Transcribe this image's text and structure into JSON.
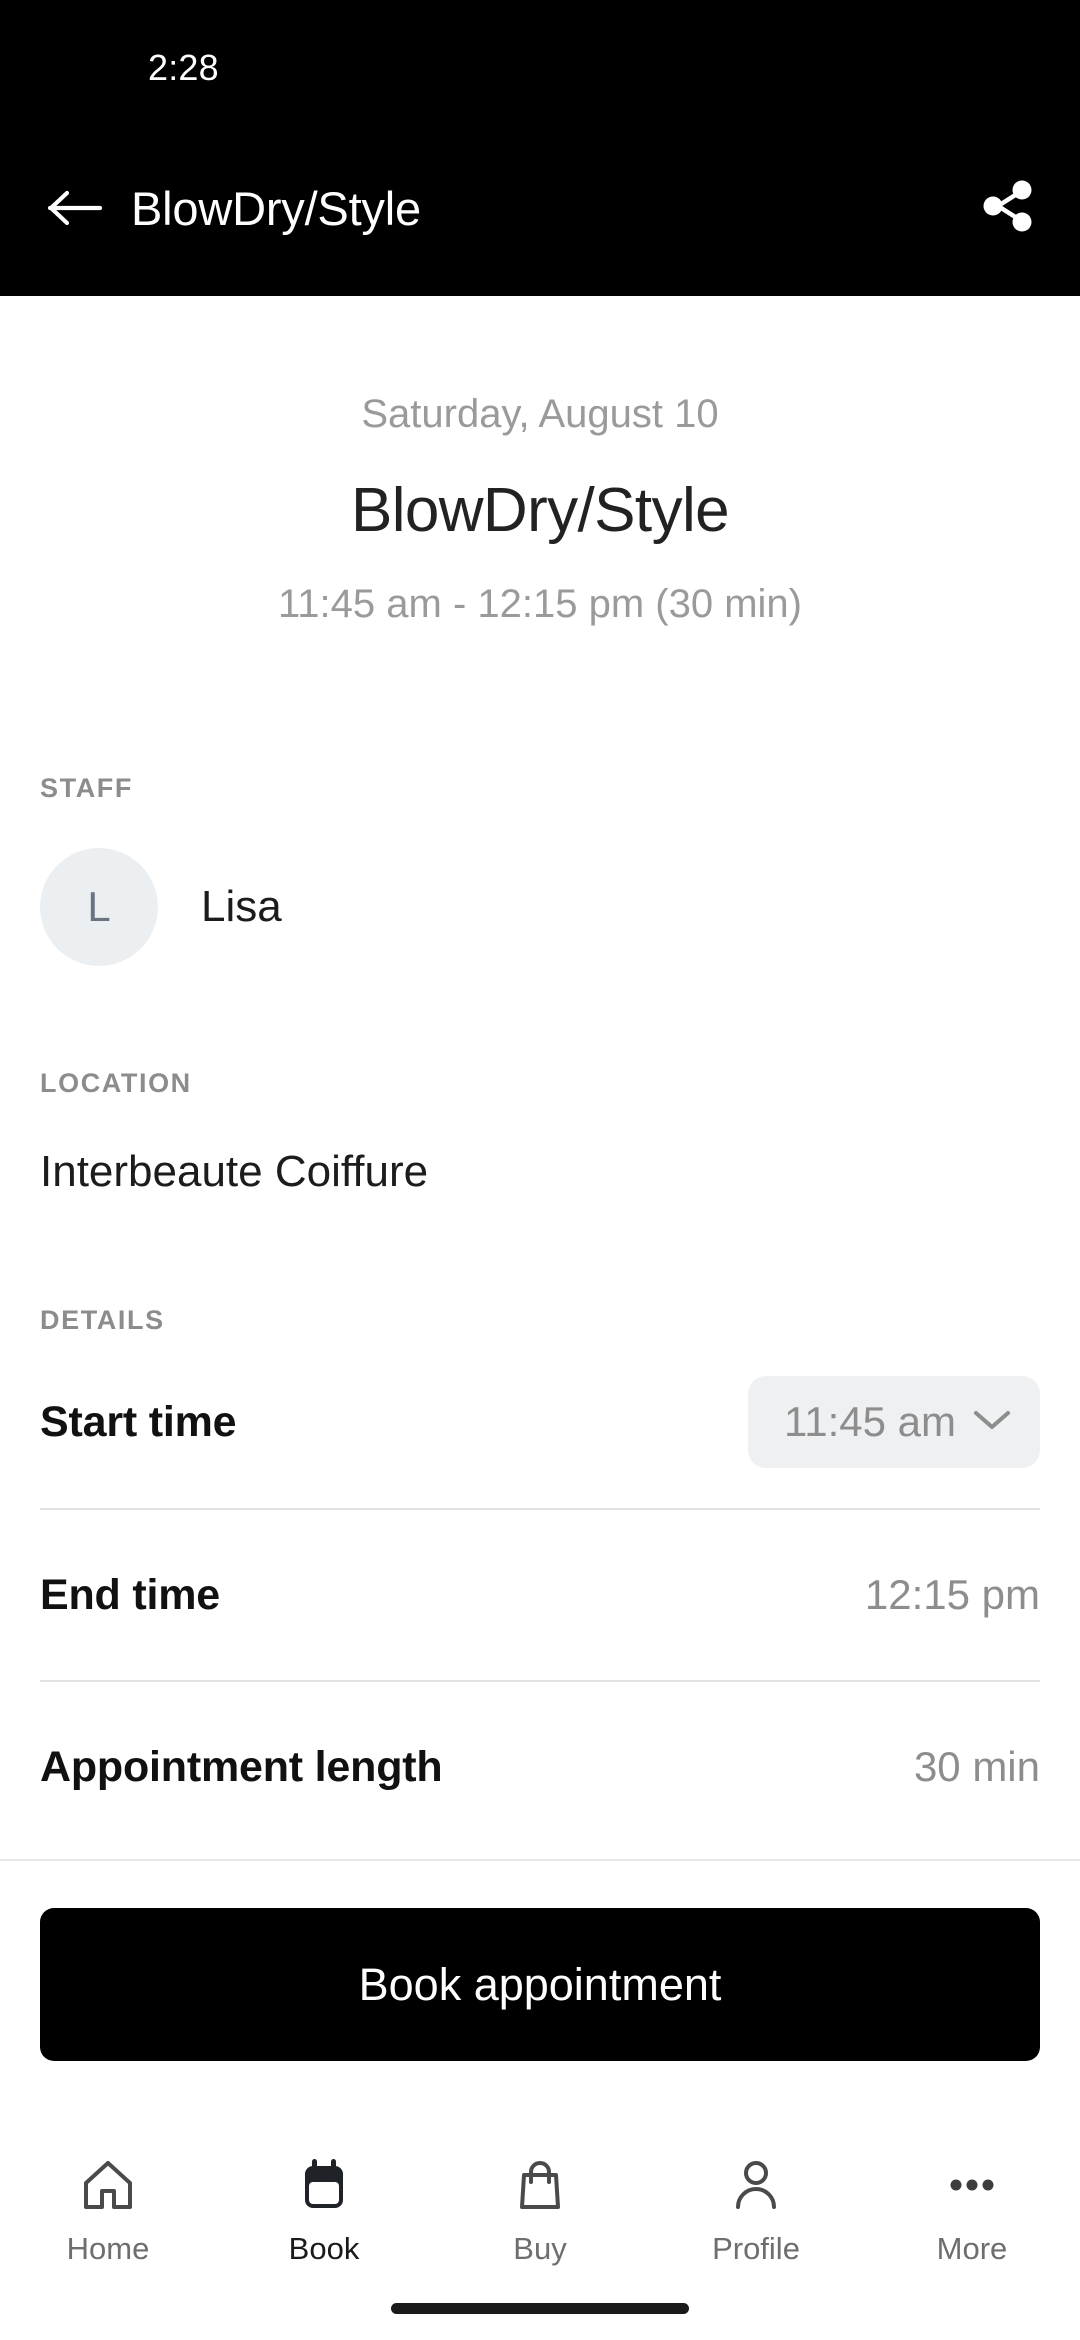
{
  "status_bar": {
    "time": "2:28"
  },
  "app_bar": {
    "back_icon": "arrow-left-icon",
    "title": "BlowDry/Style",
    "share_icon": "share-icon"
  },
  "hero": {
    "date": "Saturday, August 10",
    "service_title": "BlowDry/Style",
    "time_range": "11:45 am - 12:15 pm (30 min)"
  },
  "staff": {
    "section_label": "STAFF",
    "avatar_initial": "L",
    "name": "Lisa"
  },
  "location": {
    "section_label": "LOCATION",
    "name": "Interbeaute Coiffure"
  },
  "details": {
    "section_label": "DETAILS",
    "rows": [
      {
        "key": "Start time",
        "value": "11:45 am",
        "control": "dropdown",
        "chevron_icon": "chevron-down-icon"
      },
      {
        "key": "End time",
        "value": "12:15 pm",
        "control": "text"
      },
      {
        "key": "Appointment length",
        "value": "30 min",
        "control": "text"
      }
    ]
  },
  "cta": {
    "label": "Book appointment"
  },
  "tab_bar": {
    "items": [
      {
        "label": "Home",
        "icon": "home-icon",
        "active": false
      },
      {
        "label": "Book",
        "icon": "calendar-icon",
        "active": true
      },
      {
        "label": "Buy",
        "icon": "shopping-bag-icon",
        "active": false
      },
      {
        "label": "Profile",
        "icon": "person-icon",
        "active": false
      },
      {
        "label": "More",
        "icon": "ellipsis-icon",
        "active": false
      }
    ]
  },
  "colors": {
    "header_background": "#000000",
    "page_background": "#ffffff",
    "primary_text": "#1c1c1c",
    "muted_text": "#8d8d8d",
    "section_label": "#8c8c8c",
    "pill_background": "#eef0f2",
    "avatar_background": "#ECEFF1",
    "divider": "#e3e3e3",
    "cta_background": "#000000",
    "cta_text": "#ffffff"
  }
}
